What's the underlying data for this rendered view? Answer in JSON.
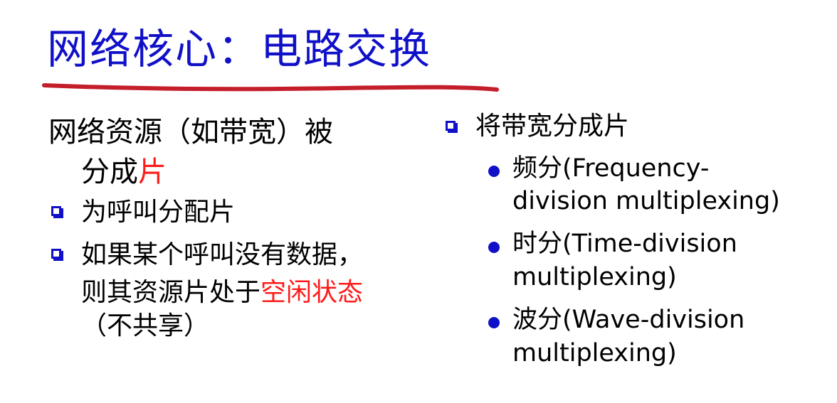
{
  "title": "网络核心：电路交换",
  "colors": {
    "title": "#1010c8",
    "underline": "#c41e2a",
    "accent": "#ff1a1a",
    "bullet": "#1010c8"
  },
  "left": {
    "lead_part1": "网络资源（如带宽）被",
    "lead_part2_prefix": "分成",
    "lead_part2_accent": "片",
    "items": [
      {
        "line1": "为呼叫分配片"
      },
      {
        "line1": "如果某个呼叫没有数据，",
        "line2_prefix": "则其资源片处于",
        "line2_accent": "空闲状态",
        "line3": "（不共享）"
      }
    ]
  },
  "right": {
    "heading": "将带宽分成片",
    "items": [
      {
        "line1": "频分(Frequency-",
        "line2": "division multiplexing)"
      },
      {
        "line1": "时分(Time-division",
        "line2": "multiplexing)"
      },
      {
        "line1": "波分(Wave-division",
        "line2": "multiplexing)"
      }
    ]
  }
}
